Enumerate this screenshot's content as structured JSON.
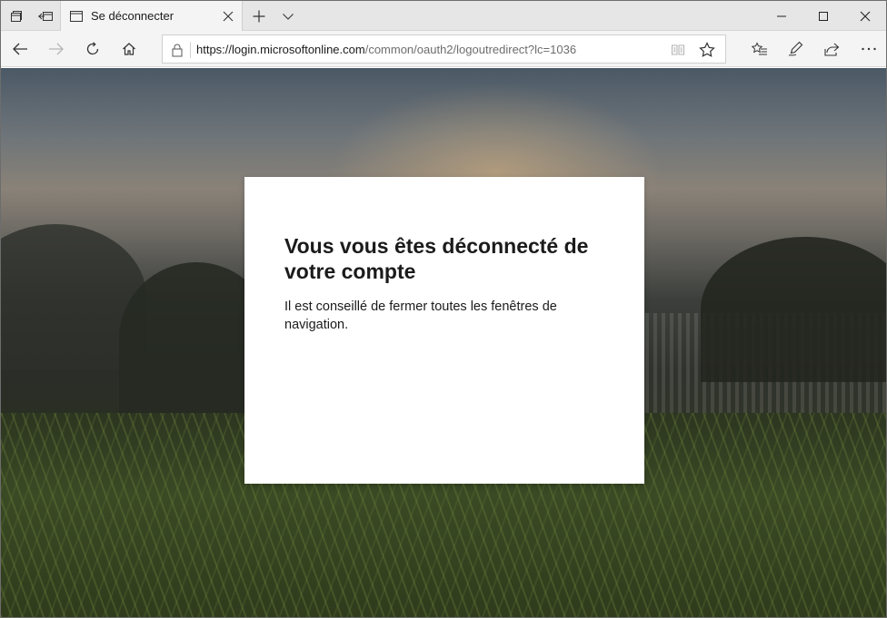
{
  "browser": {
    "tab": {
      "title": "Se déconnecter"
    },
    "address": {
      "url_host": "https://login.microsoftonline.com",
      "url_path": "/common/oauth2/logoutredirect?lc=1036"
    },
    "icons": {
      "tab_sets": "tab-sets-icon",
      "set_aside": "set-aside-tabs-icon",
      "new_tab": "plus-icon",
      "tab_preview": "chevron-down-icon",
      "back": "back-arrow-icon",
      "forward": "forward-arrow-icon",
      "refresh": "refresh-icon",
      "home": "home-icon",
      "lock": "lock-icon",
      "reading_view": "reading-view-icon",
      "favorite": "star-icon",
      "favorites_hub": "favorites-hub-icon",
      "notes": "pen-icon",
      "share": "share-icon",
      "more": "more-icon"
    }
  },
  "page": {
    "title": "Vous vous êtes déconnecté de votre compte",
    "message": "Il est conseillé de fermer toutes les fenêtres de navigation."
  }
}
